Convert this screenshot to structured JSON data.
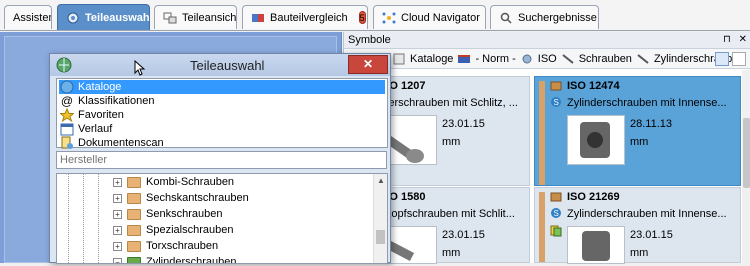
{
  "tabs": [
    {
      "label": "Assistent",
      "icon": "none"
    },
    {
      "label": "Teileauswahl",
      "icon": "gear-icon",
      "active": true
    },
    {
      "label": "Teileansicht",
      "icon": "parts-view-icon"
    },
    {
      "label": "Bauteilvergleich",
      "icon": "compare-icon",
      "badge": "5"
    },
    {
      "label": "Cloud Navigator",
      "icon": "cloud-navigator-icon"
    },
    {
      "label": "Suchergebnisse",
      "icon": "search-icon"
    }
  ],
  "symbols_panel": {
    "title": "Symbole",
    "pin": "⊓",
    "close": "✕",
    "breadcrumb": [
      "Kataloge",
      "- Norm -",
      "ISO",
      "Schrauben",
      "Zylinderschrauben"
    ],
    "cards": [
      {
        "title": "ISO 1207",
        "desc": "Zylinderschrauben mit Schlitz, ...",
        "date": "23.01.15",
        "unit": "mm",
        "selected": false
      },
      {
        "title": "ISO 12474",
        "desc": "Zylinderschrauben mit Innense...",
        "date": "28.11.13",
        "unit": "mm",
        "selected": true
      },
      {
        "title": "ISO 1580",
        "desc": "Flachkopfschrauben mit Schlit...",
        "date": "23.01.15",
        "unit": "mm",
        "selected": false
      },
      {
        "title": "ISO 21269",
        "desc": "Zylinderschrauben mit Innense...",
        "date": "23.01.15",
        "unit": "mm",
        "selected": false
      }
    ]
  },
  "dialog": {
    "title": "Teileauswahl",
    "close": "✕",
    "nav": [
      {
        "label": "Kataloge",
        "icon": "globe-icon",
        "selected": true
      },
      {
        "label": "Klassifikationen",
        "icon": "at-icon"
      },
      {
        "label": "Favoriten",
        "icon": "star-icon"
      },
      {
        "label": "Verlauf",
        "icon": "calendar-icon"
      },
      {
        "label": "Dokumentenscan",
        "icon": "document-scan-icon"
      }
    ],
    "search_placeholder": "Hersteller",
    "tree": [
      "Kombi-Schrauben",
      "Sechskantschrauben",
      "Senkschrauben",
      "Spezialschrauben",
      "Torxschrauben",
      "Zylinderschrauben"
    ]
  },
  "colors": {
    "active_tab": "#5b8fc9",
    "selected_card": "#5aa3d9",
    "close_button": "#c9463d"
  }
}
